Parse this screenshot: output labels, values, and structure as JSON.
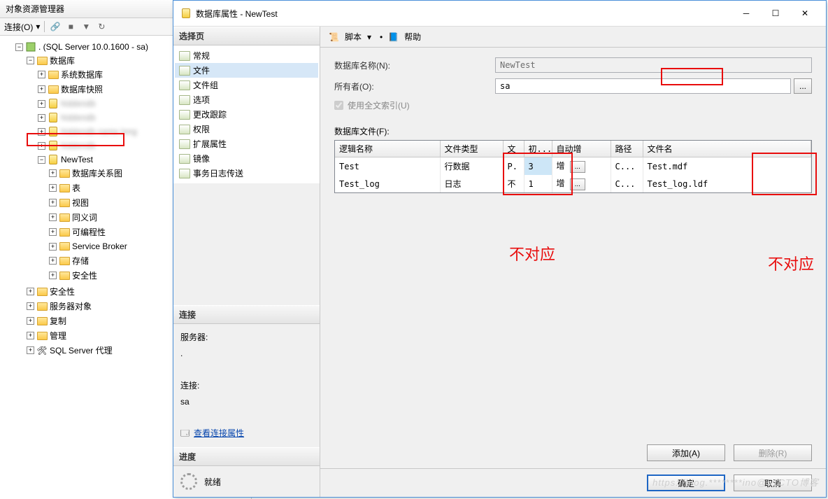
{
  "main_window": {
    "title": "对象资源管理器",
    "toolbar": {
      "connect_label": "连接(O)"
    },
    "tree": {
      "server": ". (SQL Server 10.0.1600 - sa)",
      "n_databases": "数据库",
      "n_sysdb": "系统数据库",
      "n_dbsnap": "数据库快照",
      "n_newtest": "NewTest",
      "n_diagrams": "数据库关系图",
      "n_tables": "表",
      "n_views": "视图",
      "n_synonyms": "同义词",
      "n_prog": "可编程性",
      "n_sb": "Service Broker",
      "n_storage": "存储",
      "n_security_db": "安全性",
      "n_security": "安全性",
      "n_serverobj": "服务器对象",
      "n_replication": "复制",
      "n_management": "管理",
      "n_agent": "SQL Server 代理"
    }
  },
  "dialog": {
    "title": "数据库属性 - NewTest",
    "select_page_hdr": "选择页",
    "pages": [
      "常规",
      "文件",
      "文件组",
      "选项",
      "更改跟踪",
      "权限",
      "扩展属性",
      "镜像",
      "事务日志传送"
    ],
    "active_page_index": 1,
    "connection_hdr": "连接",
    "server_label": "服务器:",
    "server_value": ".",
    "conn_label": "连接:",
    "conn_value": "sa",
    "view_conn_props": "查看连接属性",
    "progress_hdr": "进度",
    "progress_status": "就绪",
    "script_label": "脚本",
    "help_label": "帮助",
    "form": {
      "dbname_label": "数据库名称(N):",
      "dbname_value": "NewTest",
      "owner_label": "所有者(O):",
      "owner_value": "sa",
      "fulltext_label": "使用全文索引(U)",
      "files_label": "数据库文件(F):"
    },
    "grid": {
      "cols": [
        "逻辑名称",
        "文件类型",
        "文",
        "初...",
        "自动增",
        "路径",
        "文件名"
      ],
      "rows": [
        {
          "logical": "Test",
          "type": "行数据",
          "fg": "P.",
          "init": "3",
          "grow": "增",
          "path": "C...",
          "file": "Test.mdf"
        },
        {
          "logical": "Test_log",
          "type": "日志",
          "fg": "不",
          "init": "1",
          "grow": "增",
          "path": "C...",
          "file": "Test_log.ldf"
        }
      ]
    },
    "add_btn": "添加(A)",
    "remove_btn": "删除(R)",
    "ok_btn": "确定",
    "cancel_btn": "取消"
  },
  "annotations": {
    "a1": "不对应",
    "a2": "不对应"
  },
  "watermark": "https://blog.********ino@51CTO博客"
}
